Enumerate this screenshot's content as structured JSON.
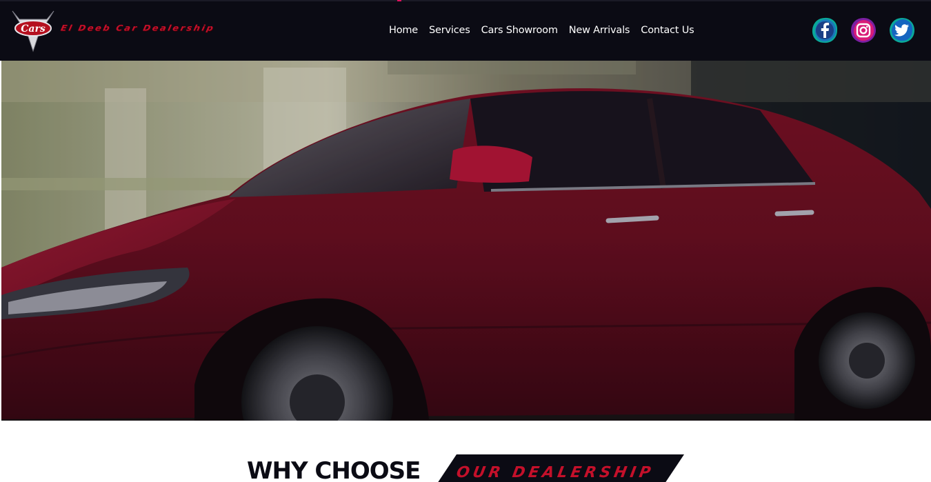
{
  "brand": {
    "logo_text": "Cars",
    "name": "El Deeb Car Dealership"
  },
  "nav": {
    "items": [
      "Home",
      "Services",
      "Cars Showroom",
      "New Arrivals",
      "Contact Us"
    ]
  },
  "social": {
    "icons": [
      "facebook-icon",
      "instagram-icon",
      "twitter-icon"
    ]
  },
  "hero": {
    "image": "red-sedan-car"
  },
  "why_section": {
    "heading_plain": "WHY CHOOSE",
    "heading_tag": "OUR DEALERSHIP"
  },
  "colors": {
    "header_bg": "#0b0b14",
    "brand_red": "#c4102a",
    "nav_text": "#ffffff"
  }
}
